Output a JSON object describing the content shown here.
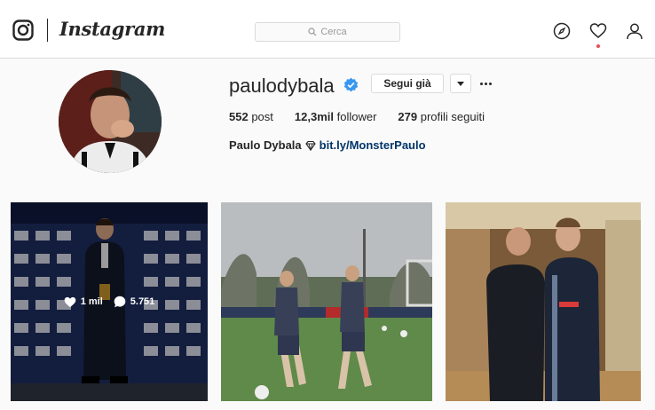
{
  "brand": {
    "wordmark": "Instagram",
    "icon": "instagram-camera-icon"
  },
  "search": {
    "placeholder": "Cerca",
    "icon": "search-icon"
  },
  "nav": {
    "icons": [
      "compass-icon",
      "heart-icon",
      "user-icon"
    ],
    "notification_dot": true
  },
  "profile": {
    "username": "paulodybala",
    "verified": true,
    "follow_button": "Segui già",
    "stats": [
      {
        "value": "552",
        "label": "post"
      },
      {
        "value": "12,3mil",
        "label": "follower"
      },
      {
        "value": "279",
        "label": "profili seguiti"
      }
    ],
    "bio": {
      "name": "Paulo Dybala",
      "emoji": "diamond-emoji",
      "link": "bit.ly/MonsterPaulo"
    }
  },
  "posts": [
    {
      "likes": "1 mil",
      "comments": "5.751",
      "hover": true
    },
    {
      "hover": false
    },
    {
      "hover": false
    }
  ],
  "colors": {
    "verified": "#3897f0",
    "link": "#003569",
    "notification": "#ed4956",
    "border": "#dbdbdb"
  }
}
